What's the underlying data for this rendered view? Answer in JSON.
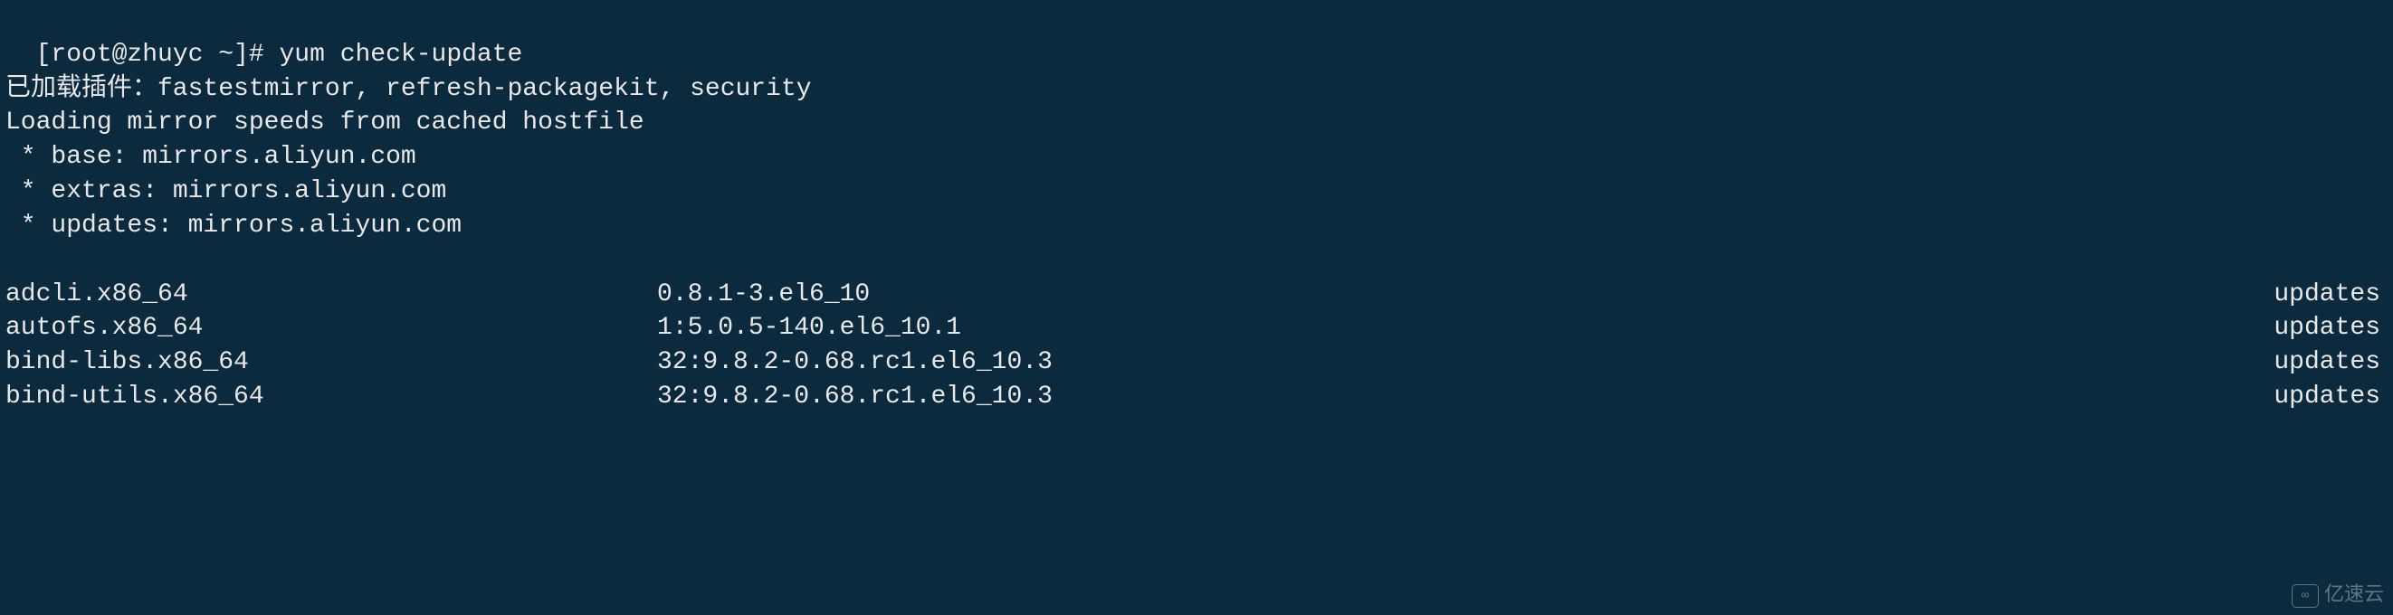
{
  "prompt": {
    "bracket_open": "[",
    "user_host": "root@zhuyc",
    "tilde": " ~",
    "bracket_close": "]# ",
    "command": "yum check-update"
  },
  "output_lines": {
    "plugins": "已加载插件：fastestmirror, refresh-packagekit, security",
    "loading": "Loading mirror speeds from cached hostfile",
    "base": " * base: mirrors.aliyun.com",
    "extras": " * extras: mirrors.aliyun.com",
    "updates": " * updates: mirrors.aliyun.com"
  },
  "packages": [
    {
      "name": "adcli.x86_64",
      "version": "0.8.1-3.el6_10",
      "repo": "updates"
    },
    {
      "name": "autofs.x86_64",
      "version": "1:5.0.5-140.el6_10.1",
      "repo": "updates"
    },
    {
      "name": "bind-libs.x86_64",
      "version": "32:9.8.2-0.68.rc1.el6_10.3",
      "repo": "updates"
    },
    {
      "name": "bind-utils.x86_64",
      "version": "32:9.8.2-0.68.rc1.el6_10.3",
      "repo": "updates"
    }
  ],
  "watermark": {
    "text": "亿速云"
  }
}
